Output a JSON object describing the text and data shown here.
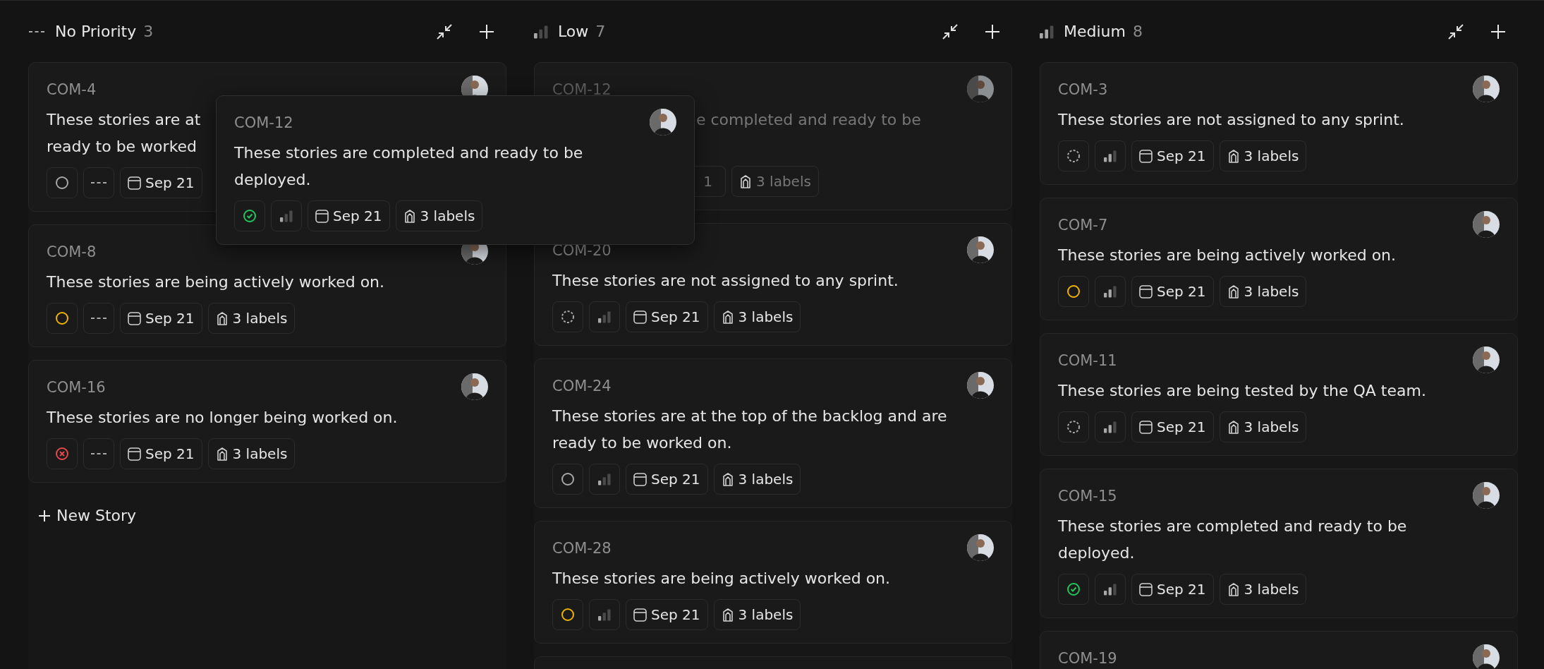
{
  "columns": [
    {
      "icon": {
        "kind": "none"
      },
      "title": "No Priority",
      "count": "3",
      "new_story": "New Story",
      "cards": [
        {
          "kind": "covered",
          "id": "COM-4",
          "lines": [
            "These stories are at",
            "ready to be worked"
          ],
          "status": {
            "kind": "todo"
          },
          "priority": {
            "kind": "none"
          },
          "date": "Sep 21"
        },
        {
          "kind": "card",
          "id": "COM-8",
          "description": "These stories are being actively worked on.",
          "status": {
            "kind": "in_progress"
          },
          "priority": {
            "kind": "none"
          },
          "date": "Sep 21",
          "labels": "3 labels"
        },
        {
          "kind": "card",
          "id": "COM-16",
          "description": "These stories are no longer being worked on.",
          "status": {
            "kind": "canceled"
          },
          "priority": {
            "kind": "none"
          },
          "date": "Sep 21",
          "labels": "3 labels"
        }
      ]
    },
    {
      "icon": {
        "kind": "low"
      },
      "title": "Low",
      "count": "7",
      "cards": [
        {
          "kind": "ghost",
          "id": "COM-12",
          "fragment": "e completed and ready to be",
          "date_fragment": "1",
          "labels": "3 labels"
        },
        {
          "kind": "card",
          "id": "COM-20",
          "description": "These stories are not assigned to any sprint.",
          "status": {
            "kind": "backlog"
          },
          "priority": {
            "kind": "low"
          },
          "date": "Sep 21",
          "labels": "3 labels"
        },
        {
          "kind": "card",
          "id": "COM-24",
          "description": "These stories are at the top of the backlog and are ready to be worked on.",
          "status": {
            "kind": "todo"
          },
          "priority": {
            "kind": "low"
          },
          "date": "Sep 21",
          "labels": "3 labels"
        },
        {
          "kind": "card",
          "id": "COM-28",
          "description": "These stories are being actively worked on.",
          "status": {
            "kind": "in_progress"
          },
          "priority": {
            "kind": "low"
          },
          "date": "Sep 21",
          "labels": "3 labels"
        },
        {
          "kind": "stub"
        }
      ]
    },
    {
      "icon": {
        "kind": "medium"
      },
      "title": "Medium",
      "count": "8",
      "cards": [
        {
          "kind": "card",
          "id": "COM-3",
          "description": "These stories are not assigned to any sprint.",
          "status": {
            "kind": "backlog"
          },
          "priority": {
            "kind": "medium"
          },
          "date": "Sep 21",
          "labels": "3 labels"
        },
        {
          "kind": "card",
          "id": "COM-7",
          "description": "These stories are being actively worked on.",
          "status": {
            "kind": "in_progress"
          },
          "priority": {
            "kind": "medium"
          },
          "date": "Sep 21",
          "labels": "3 labels"
        },
        {
          "kind": "card",
          "id": "COM-11",
          "description": "These stories are being tested by the QA team.",
          "status": {
            "kind": "backlog"
          },
          "priority": {
            "kind": "medium"
          },
          "date": "Sep 21",
          "labels": "3 labels"
        },
        {
          "kind": "card",
          "id": "COM-15",
          "description": "These stories are completed and ready to be deployed.",
          "status": {
            "kind": "done"
          },
          "priority": {
            "kind": "medium"
          },
          "date": "Sep 21",
          "labels": "3 labels"
        },
        {
          "kind": "partial",
          "id": "COM-19"
        }
      ]
    }
  ],
  "drag_preview": {
    "id": "COM-12",
    "description": "These stories are completed and ready to be deployed.",
    "status": {
      "kind": "done"
    },
    "priority": {
      "kind": "low"
    },
    "date": "Sep 21",
    "labels": "3 labels"
  }
}
